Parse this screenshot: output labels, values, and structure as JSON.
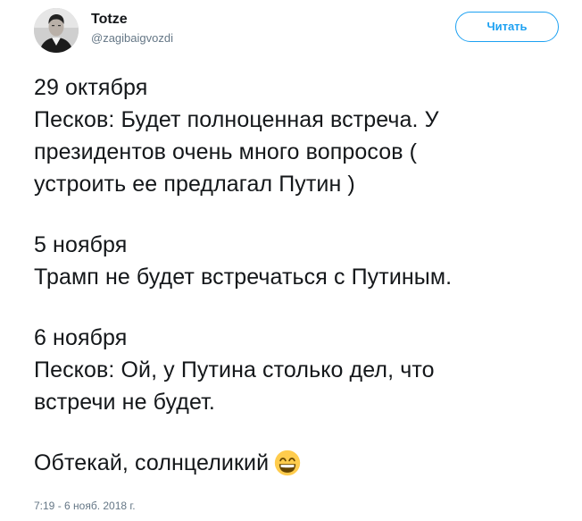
{
  "user": {
    "display_name": "Totze",
    "handle": "@zagibaigvozdi"
  },
  "follow_button": {
    "label": "Читать",
    "color": "#1da1f2"
  },
  "tweet": {
    "paragraphs": [
      {
        "lines": [
          "29 октября",
          "Песков: Будет полноценная встреча. У",
          "президентов очень много вопросов (",
          "устроить ее предлагал Путин )"
        ]
      },
      {
        "lines": [
          "5 ноября",
          "Трамп не будет встречаться с Путиным."
        ]
      },
      {
        "lines": [
          "6 ноября",
          "Песков: Ой, у Путина столько дел, что",
          "встречи не будет."
        ]
      },
      {
        "lines": [
          "Обтекай, солнцеликий"
        ],
        "emoji": "grinning-face-with-smiling-eyes-icon"
      }
    ],
    "timestamp": "7:19 - 6 нояб. 2018 г."
  }
}
